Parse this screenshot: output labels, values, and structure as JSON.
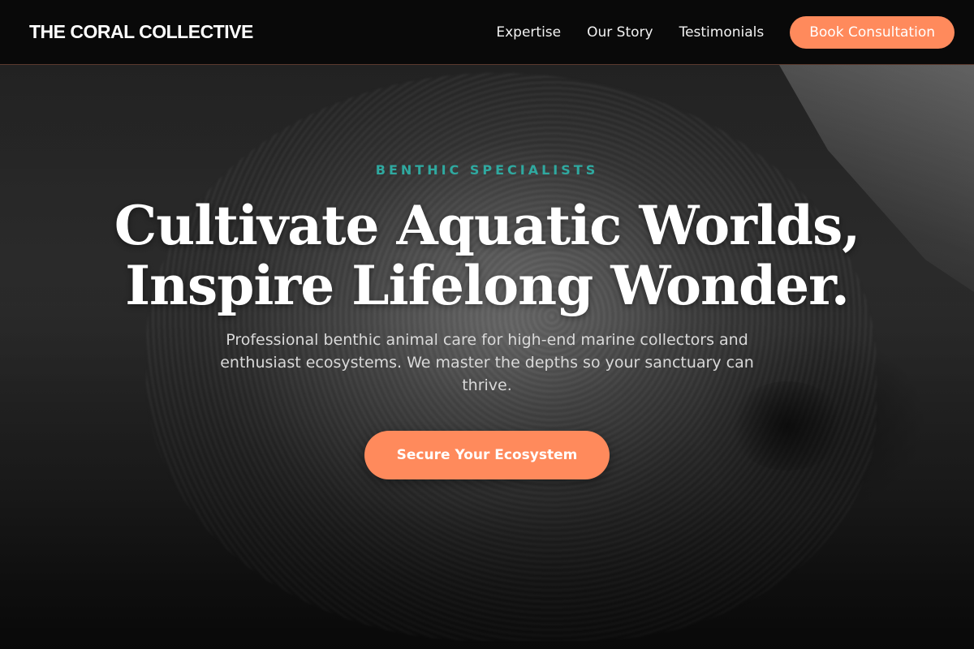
{
  "nav": {
    "brand": "THE CORAL COLLECTIVE",
    "links": [
      "Expertise",
      "Our Story",
      "Testimonials"
    ],
    "cta_label": "Book Consultation"
  },
  "hero": {
    "eyebrow": "BENTHIC SPECIALISTS",
    "headline_line1": "Cultivate Aquatic Worlds,",
    "headline_line2": "Inspire Lifelong Wonder.",
    "subtext": "Professional benthic animal care for high-end marine collectors and enthusiast ecosystems. We master the depths so your sanctuary can thrive.",
    "cta_label": "Secure Your Ecosystem"
  },
  "colors": {
    "accent": "#ff8a5c",
    "eyebrow": "#2fa9a0",
    "nav_bg": "#080808"
  }
}
